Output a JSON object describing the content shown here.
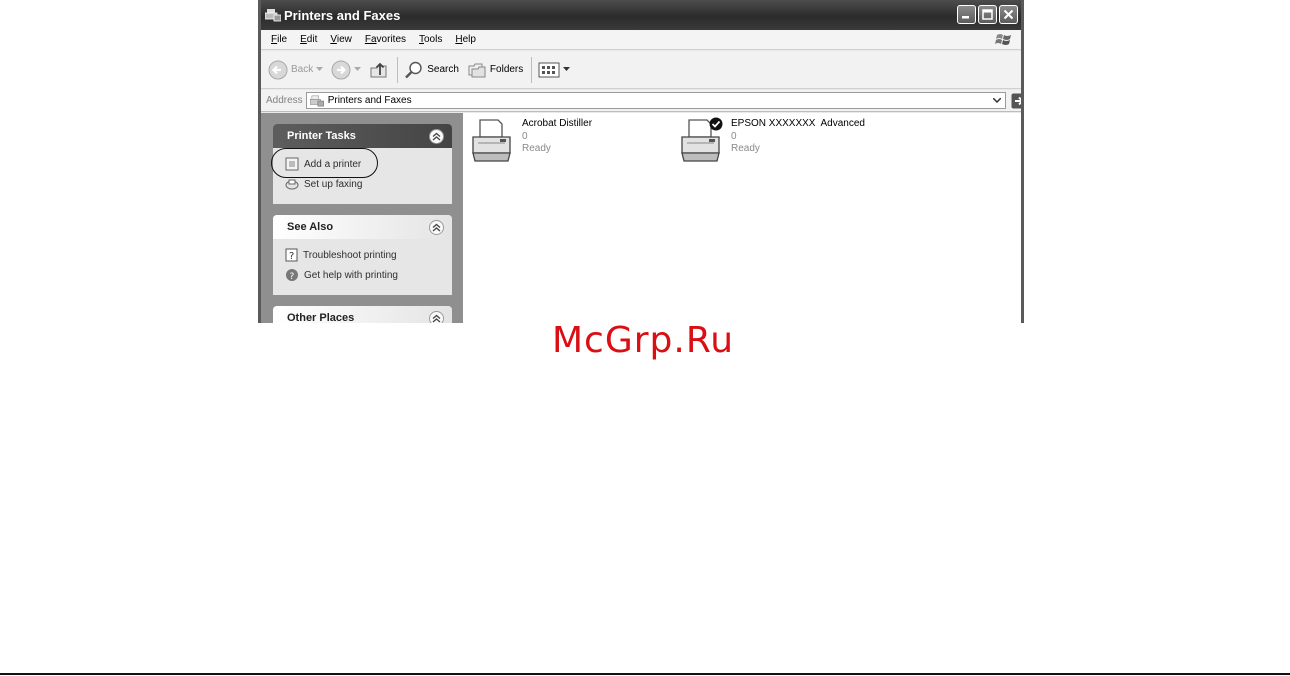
{
  "window": {
    "title": "Printers and Faxes"
  },
  "menu": {
    "items": [
      {
        "label": "File",
        "accel": "F",
        "rest": "ile"
      },
      {
        "label": "Edit",
        "accel": "E",
        "rest": "dit"
      },
      {
        "label": "View",
        "accel": "V",
        "rest": "iew"
      },
      {
        "label": "Favorites",
        "accel": "Fa",
        "rest": "vorites"
      },
      {
        "label": "Tools",
        "accel": "T",
        "rest": "ools"
      },
      {
        "label": "Help",
        "accel": "H",
        "rest": "elp"
      }
    ]
  },
  "toolbar": {
    "back_label": "Back",
    "search_label": "Search",
    "folders_label": "Folders"
  },
  "address": {
    "label": "Address",
    "value": "Printers and Faxes",
    "go_label": "Go"
  },
  "taskpane": {
    "printer_tasks": {
      "title": "Printer Tasks",
      "links": [
        "Add a printer",
        "Set up faxing"
      ]
    },
    "see_also": {
      "title": "See Also",
      "links": [
        "Troubleshoot printing",
        "Get help with printing"
      ]
    },
    "other_places": {
      "title": "Other Places"
    }
  },
  "printers": [
    {
      "name": "Acrobat Distiller",
      "docs": "0",
      "status": "Ready",
      "is_default": false
    },
    {
      "name": "EPSON XXXXXXX  Advanced",
      "docs": "0",
      "status": "Ready",
      "is_default": true
    }
  ],
  "watermark": "McGrp.Ru",
  "colors": {
    "watermark": "#d90f14",
    "titlebar": "#3a3a3a",
    "taskpane_bg": "#8f8f8f"
  }
}
